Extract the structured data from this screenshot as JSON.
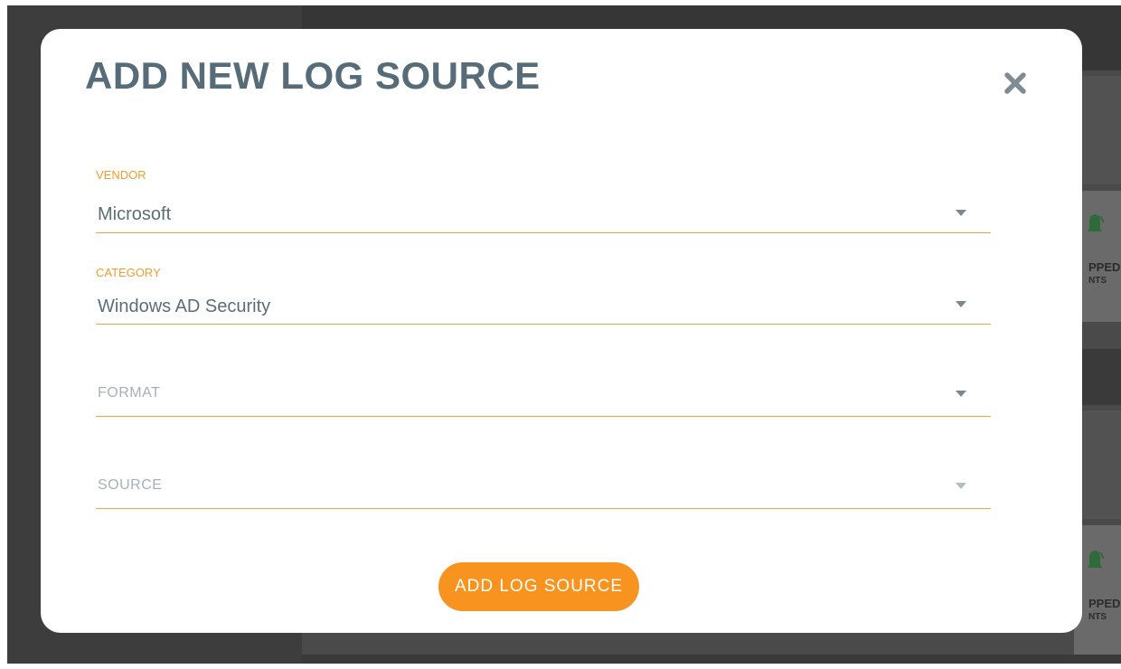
{
  "background": {
    "card_label_line1": "PPED",
    "card_label_line2": "NTS"
  },
  "modal": {
    "title": "ADD NEW LOG SOURCE",
    "close_icon": "close-icon",
    "fields": {
      "vendor": {
        "label": "VENDOR",
        "value": "Microsoft"
      },
      "category": {
        "label": "CATEGORY",
        "value": "Windows AD Security"
      },
      "format": {
        "placeholder": "FORMAT"
      },
      "source": {
        "placeholder": "SOURCE"
      }
    },
    "submit_label": "ADD LOG SOURCE"
  },
  "colors": {
    "accent_orange": "#f7931e",
    "label_orange": "#f39c2b",
    "title_slate": "#566c78",
    "overlay_dark": "#4a4a4a"
  }
}
